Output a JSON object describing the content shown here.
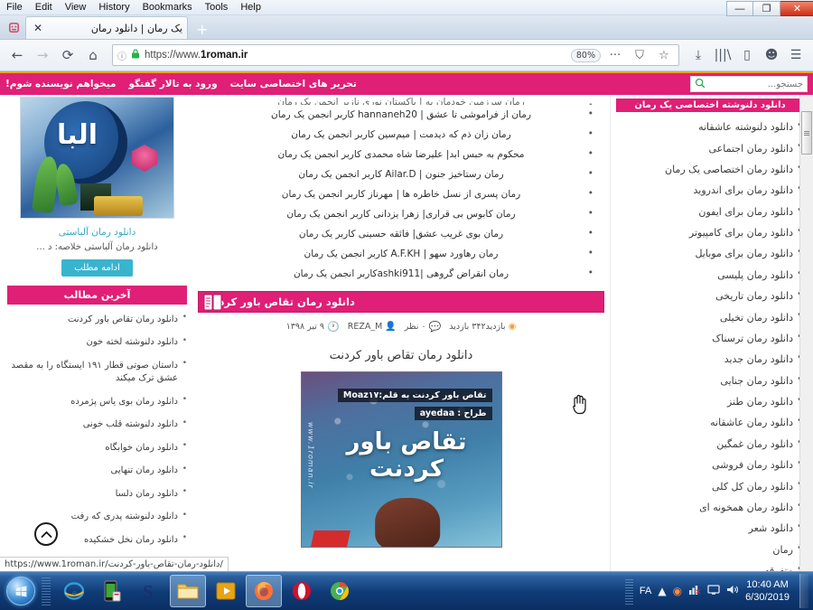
{
  "browser": {
    "menubar": [
      "File",
      "Edit",
      "View",
      "History",
      "Bookmarks",
      "Tools",
      "Help"
    ],
    "tab_title": "یک رمان | دانلود رمان",
    "new_tab_label": "+",
    "url_prefix": "https://www.",
    "url_bold": "1roman.ir",
    "zoom_level": "80%",
    "window_controls": {
      "minimize": "—",
      "maximize": "❐",
      "close": "✕"
    },
    "nav": {
      "back": "←",
      "forward": "→",
      "reload": "⟳",
      "home": "⌂",
      "info": "ⓘ",
      "lock": "🔒",
      "more": "···",
      "shield": "⛉",
      "bookmark": "☆",
      "downloads": "⤓",
      "library": "|||\\",
      "sidebar": "▯",
      "account": "☻",
      "menu": "☰"
    },
    "status_url": "https://www.1roman.ir/دانلود-رمان-تقاص-باور-کردنت/"
  },
  "site": {
    "nav_items": [
      "تحریر های اختصاصی سایت",
      "ورود به تالار گفتگو",
      "میخواهم نویسنده شوم!"
    ],
    "search_placeholder": "جستجو...",
    "search_value": "",
    "search_icon": "search-icon"
  },
  "categories": {
    "header_clipped": "دانلود دلنوشته اختصاصی یک رمان",
    "items": [
      "دانلود دلنوشته عاشقانه",
      "دانلود رمان اجتماعی",
      "دانلود رمان اختصاصی یک رمان",
      "دانلود رمان برای اندروید",
      "دانلود رمان برای ایفون",
      "دانلود رمان برای کامپیوتر",
      "دانلود رمان برای موبایل",
      "دانلود رمان پلیسی",
      "دانلود رمان تاریخی",
      "دانلود رمان تخیلی",
      "دانلود رمان ترسناک",
      "دانلود رمان جدید",
      "دانلود رمان جنایی",
      "دانلود رمان طنز",
      "دانلود رمان عاشقانه",
      "دانلود رمان غمگین",
      "دانلود رمان فروشی",
      "دانلود رمان کل کلی",
      "دانلود رمان همخونه ای",
      "دانلود شعر",
      "رمان",
      "متفرقه"
    ]
  },
  "top_links": {
    "clipped": "رمان سرزمین خودمان به | پاکستان نوری نازبر انجمن یک رمان",
    "items": [
      "رمان از فراموشی تا عشق | hannaneh20 کاربر انجمن یک رمان",
      "رمان زان ذم که دیدمت | میم‌سین کاربر انجمن یک رمان",
      "محکوم به حبس ابد| علیرضا شاه محمدی کاربر انجمن یک رمان",
      "رمان رستاخیز جنون | Ailar.D کاربر انجمن یک رمان",
      "رمان پسری از نسل خاطره ها | مهرناز کاربر انجمن یک رمان",
      "رمان کابوس بی قراری| زهرا یزدانی کاربر انجمن یک رمان",
      "رمان بوی غریب عشق| فائقه حسینی کاربر یک رمان",
      "رمان رهاورد سهو | A.F.KH کاربر انجمن یک رمان",
      "رمان انقراض گروهی |ashki911کاربر انجمن یک رمان"
    ]
  },
  "article": {
    "banner_title": "دانلود رمان تقاص باور کردنت",
    "banner_icon": "book-icon",
    "post_title": "دانلود رمان تقاص باور کردنت",
    "meta": {
      "views": "بازدید۳۴۲ بازدید",
      "comments": "۰ نظر",
      "author": "REZA_M",
      "date": "۹ تیر ۱۳۹۸"
    },
    "cover": {
      "line1": "تقاص باور کردنت  به قلم:Moaz۱۷",
      "line2": "طراح : ayedaa",
      "big_title": "تقاص باور کردنت",
      "watermark": "www.1roman.ir"
    }
  },
  "promo": {
    "link": "دانلود رمان آلباستی",
    "excerpt": "دانلود رمان آلباستی        خلاصه: د ...",
    "more_label": "ادامه مطلب"
  },
  "latest": {
    "header": "آخرین مطالب",
    "items": [
      "دانلود رمان تقاص باور کردنت",
      "دانلود دلنوشته لخته خون",
      "داستان صوتی قطار ۱۹۱ ایستگاه را به مقصد عشق ترک میکند",
      "دانلود رمان بوی یاس پژمرده",
      "دانلود دلنوشته قلب خونی",
      "دانلود رمان خوابگاه",
      "دانلود رمان تنهایی",
      "دانلود رمان دلسا",
      "دانلود دلنوشته پدری که رفت",
      "دانلود رمان نخل خشکیده"
    ]
  },
  "scroll_top": {
    "icon": "chevron-up-icon"
  },
  "taskbar": {
    "start": "start-orb",
    "apps": [
      "internet-explorer-icon",
      "android-phone-icon",
      "sibelius-icon",
      "file-explorer-icon",
      "media-player-icon",
      "firefox-icon",
      "opera-icon",
      "chrome-icon"
    ],
    "tray": {
      "lang": "FA",
      "show_hidden": "▲",
      "record": "◉",
      "network": "▣",
      "monitor": "🖥",
      "volume": "🔊"
    },
    "clock_time": "10:40 AM",
    "clock_date": "6/30/2019"
  },
  "colors": {
    "brand_pink": "#e01f76",
    "accent_orange": "#f5a11d",
    "link_blue": "#3aa7c4",
    "button_teal": "#38b4cf"
  }
}
